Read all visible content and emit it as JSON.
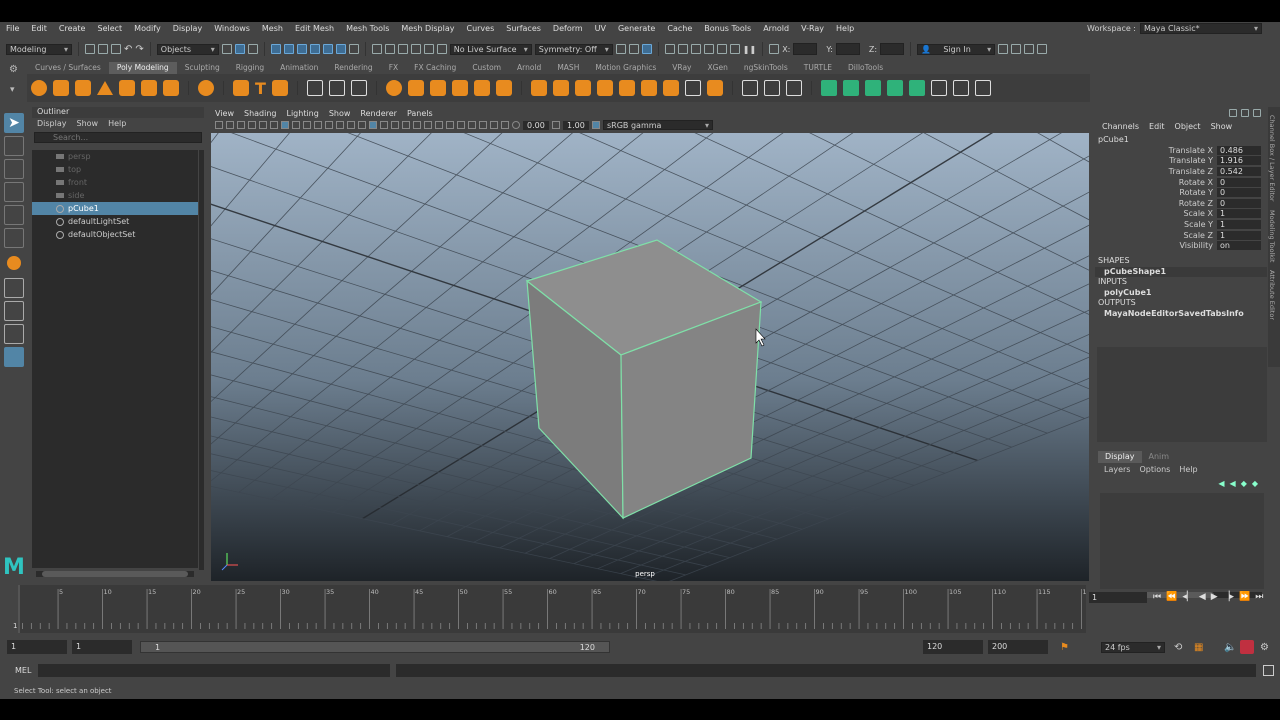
{
  "menubar": {
    "items": [
      "File",
      "Edit",
      "Create",
      "Select",
      "Modify",
      "Display",
      "Windows",
      "Mesh",
      "Edit Mesh",
      "Mesh Tools",
      "Mesh Display",
      "Curves",
      "Surfaces",
      "Deform",
      "UV",
      "Generate",
      "Cache",
      "Bonus Tools",
      "Arnold",
      "V-Ray",
      "Help"
    ],
    "workspace_label": "Workspace :",
    "workspace_value": "Maya Classic*"
  },
  "statusline": {
    "menu_set": "Modeling",
    "objects_label": "Objects",
    "live_surface": "No Live Surface",
    "symmetry": "Symmetry: Off",
    "x_label": "X:",
    "y_label": "Y:",
    "z_label": "Z:",
    "sign_in": "Sign In"
  },
  "shelf": {
    "tabs": [
      "Curves / Surfaces",
      "Poly Modeling",
      "Sculpting",
      "Rigging",
      "Animation",
      "Rendering",
      "FX",
      "FX Caching",
      "Custom",
      "Arnold",
      "MASH",
      "Motion Graphics",
      "VRay",
      "XGen",
      "ngSkinTools",
      "TURTLE",
      "DilloTools"
    ],
    "active_tab": "Poly Modeling"
  },
  "outliner": {
    "title": "Outliner",
    "menus": [
      "Display",
      "Show",
      "Help"
    ],
    "search_placeholder": "Search...",
    "items": [
      {
        "label": "persp",
        "type": "camera",
        "dim": true
      },
      {
        "label": "top",
        "type": "camera",
        "dim": true
      },
      {
        "label": "front",
        "type": "camera",
        "dim": true
      },
      {
        "label": "side",
        "type": "camera",
        "dim": true
      },
      {
        "label": "pCube1",
        "type": "mesh",
        "selected": true
      },
      {
        "label": "defaultLightSet",
        "type": "set"
      },
      {
        "label": "defaultObjectSet",
        "type": "set"
      }
    ]
  },
  "viewport": {
    "menus": [
      "View",
      "Shading",
      "Lighting",
      "Show",
      "Renderer",
      "Panels"
    ],
    "exposure": "0.00",
    "gamma": "1.00",
    "color_space": "sRGB gamma",
    "camera_label": "persp"
  },
  "channelbox": {
    "menus": [
      "Channels",
      "Edit",
      "Object",
      "Show"
    ],
    "object_name": "pCube1",
    "channels": [
      {
        "name": "Translate X",
        "value": "0.486"
      },
      {
        "name": "Translate Y",
        "value": "1.916"
      },
      {
        "name": "Translate Z",
        "value": "0.542"
      },
      {
        "name": "Rotate X",
        "value": "0"
      },
      {
        "name": "Rotate Y",
        "value": "0"
      },
      {
        "name": "Rotate Z",
        "value": "0"
      },
      {
        "name": "Scale X",
        "value": "1"
      },
      {
        "name": "Scale Y",
        "value": "1"
      },
      {
        "name": "Scale Z",
        "value": "1"
      },
      {
        "name": "Visibility",
        "value": "on"
      }
    ],
    "shapes_label": "SHAPES",
    "shape_node": "pCubeShape1",
    "inputs_label": "INPUTS",
    "input_node": "polyCube1",
    "outputs_label": "OUTPUTS",
    "output_node": "MayaNodeEditorSavedTabsInfo"
  },
  "side_tabs": [
    "Channel Box / Layer Editor",
    "Modeling Toolkit",
    "Attribute Editor"
  ],
  "layers": {
    "tabs": [
      "Display",
      "Anim"
    ],
    "menus": [
      "Layers",
      "Options",
      "Help"
    ]
  },
  "timeslider": {
    "ticks": [
      "5",
      "10",
      "15",
      "20",
      "25",
      "30",
      "35",
      "40",
      "45",
      "50",
      "55",
      "60",
      "65",
      "70",
      "75",
      "80",
      "85",
      "90",
      "95",
      "100",
      "105",
      "110",
      "115",
      "120"
    ],
    "start_marker": "1",
    "current_frame": "1"
  },
  "range": {
    "start": "1",
    "playback_start": "1",
    "slider_start": "1",
    "slider_end": "120",
    "playback_end": "120",
    "end": "200",
    "fps": "24 fps"
  },
  "cmdline": {
    "label": "MEL"
  },
  "helpline": {
    "text": "Select Tool: select an object"
  },
  "colors": {
    "accent": "#5285a6",
    "shelf_orange": "#e88b1f",
    "wire_green": "#7fe0a8"
  }
}
